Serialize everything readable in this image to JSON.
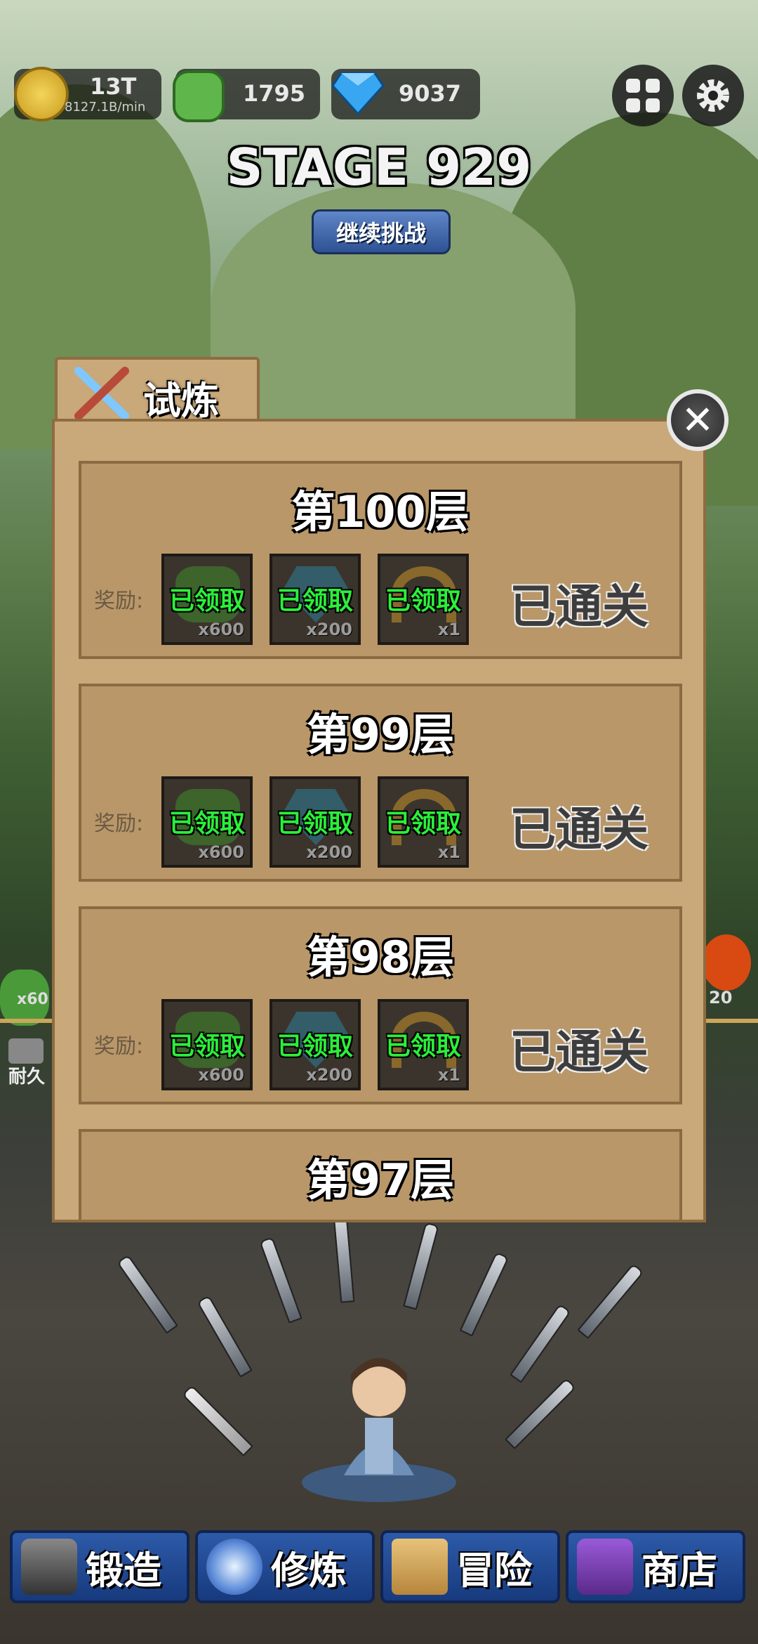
{
  "hud": {
    "gold": {
      "amount": "13T",
      "rate": "8127.1B/min"
    },
    "jade": {
      "amount": "1795"
    },
    "diamond": {
      "amount": "9037"
    }
  },
  "stage": {
    "title": "STAGE 929",
    "continue_label": "继续挑战"
  },
  "panel": {
    "tab_title": "试炼",
    "reward_label": "奖励:",
    "floors": [
      {
        "name": "第100层",
        "status": "已通关",
        "rewards": [
          {
            "icon": "jade-ore-icon",
            "state": "已领取",
            "qty": "x600"
          },
          {
            "icon": "blue-gem-icon",
            "state": "已领取",
            "qty": "x200"
          },
          {
            "icon": "horseshoe-magnet-icon",
            "state": "已领取",
            "qty": "x1"
          }
        ]
      },
      {
        "name": "第99层",
        "status": "已通关",
        "rewards": [
          {
            "icon": "jade-ore-icon",
            "state": "已领取",
            "qty": "x600"
          },
          {
            "icon": "blue-gem-icon",
            "state": "已领取",
            "qty": "x200"
          },
          {
            "icon": "horseshoe-magnet-icon",
            "state": "已领取",
            "qty": "x1"
          }
        ]
      },
      {
        "name": "第98层",
        "status": "已通关",
        "rewards": [
          {
            "icon": "jade-ore-icon",
            "state": "已领取",
            "qty": "x600"
          },
          {
            "icon": "blue-gem-icon",
            "state": "已领取",
            "qty": "x200"
          },
          {
            "icon": "horseshoe-magnet-icon",
            "state": "已领取",
            "qty": "x1"
          }
        ]
      },
      {
        "name": "第97层"
      }
    ]
  },
  "side": {
    "left_qty": "x60",
    "durability": "耐久",
    "right_qty": "20"
  },
  "nav": [
    {
      "label": "锻造",
      "icon": "anvil-icon"
    },
    {
      "label": "修炼",
      "icon": "spirit-orb-icon"
    },
    {
      "label": "冒险",
      "icon": "map-icon"
    },
    {
      "label": "商店",
      "icon": "treasure-chest-icon"
    }
  ],
  "colors": {
    "claimed_text": "#2bef3a",
    "panel": "#c9a87a",
    "nav": "#2d5aa8"
  }
}
